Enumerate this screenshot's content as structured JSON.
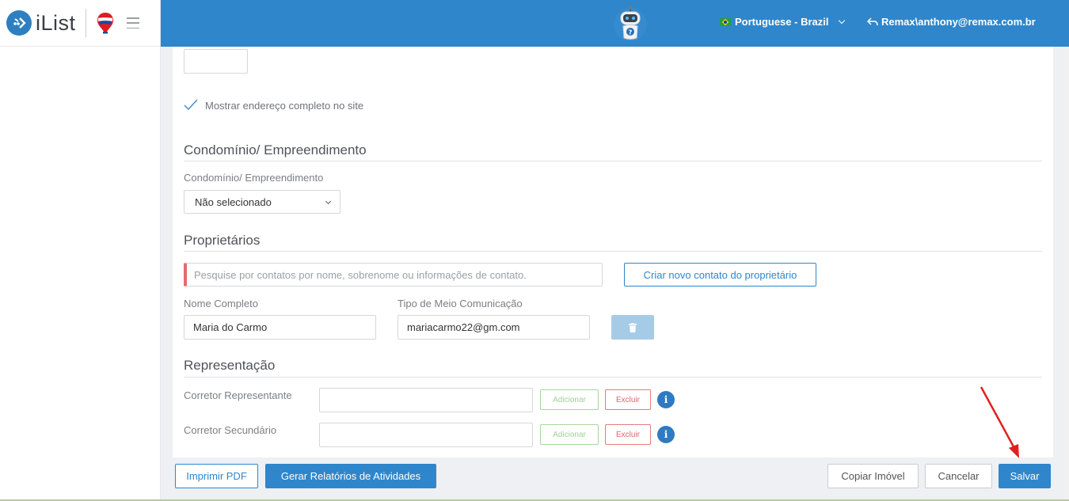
{
  "app": {
    "brand": "iList"
  },
  "header": {
    "language": "Portuguese - Brazil",
    "user": "Remax\\anthony@remax.com.br"
  },
  "address": {
    "show_full_address_label": "Mostrar endereço completo no site",
    "show_full_address_checked": true
  },
  "condo": {
    "section_title": "Condomínio/ Empreendimento",
    "field_label": "Condomínio/ Empreendimento",
    "selected": "Não selecionado"
  },
  "owners": {
    "section_title": "Proprietários",
    "search_placeholder": "Pesquise por contatos por nome, sobrenome ou informações de contato.",
    "create_button": "Criar novo contato do proprietário",
    "name_label": "Nome Completo",
    "name_value": "Maria do Carmo",
    "contact_label": "Tipo de Meio Comunicação",
    "contact_value": "mariacarmo22@gm.com"
  },
  "representation": {
    "section_title": "Representação",
    "rows": [
      {
        "label": "Corretor Representante",
        "add": "Adicionar",
        "delete": "Excluir"
      },
      {
        "label": "Corretor Secundário",
        "add": "Adicionar",
        "delete": "Excluir"
      }
    ]
  },
  "footer": {
    "print_pdf": "Imprimir PDF",
    "activity_reports": "Gerar Relatórios de Atividades",
    "copy": "Copiar Imóvel",
    "cancel": "Cancelar",
    "save": "Salvar"
  },
  "colors": {
    "primary": "#2f86cb",
    "danger": "#e0666b",
    "success": "#9fd196",
    "annotation_arrow": "#e02020"
  }
}
